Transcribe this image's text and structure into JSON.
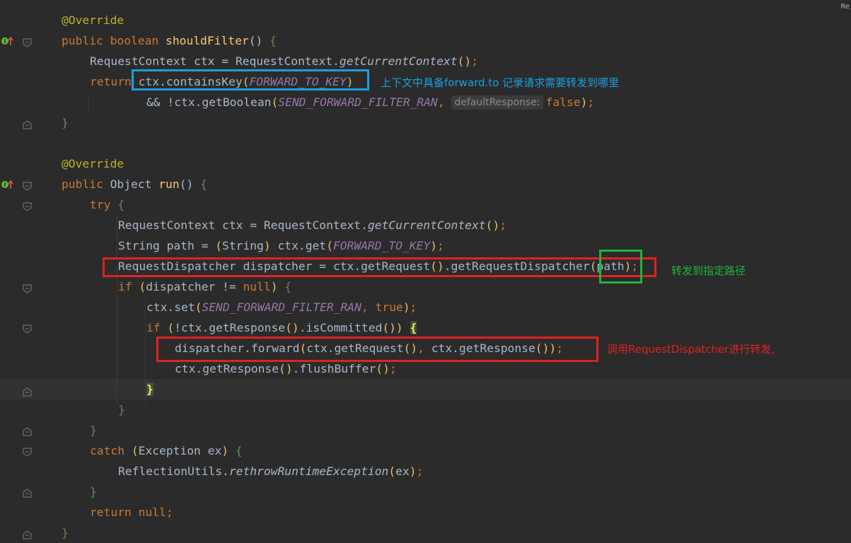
{
  "editor": {
    "corner_label": "Re",
    "lines": [
      {
        "indent": 2,
        "tokens": [
          {
            "t": "@Override",
            "c": "ann"
          }
        ]
      },
      {
        "indent": 2,
        "tokens": [
          {
            "t": "public boolean ",
            "c": "kw"
          },
          {
            "t": "shouldFilter",
            "c": "fn"
          },
          {
            "t": "() ",
            "c": "plain"
          },
          {
            "t": "{",
            "c": "brace-g"
          }
        ]
      },
      {
        "indent": 3,
        "tokens": [
          {
            "t": "RequestContext ctx = RequestContext.",
            "c": "plain"
          },
          {
            "t": "getCurrentContext",
            "c": "static-call"
          },
          {
            "t": "()",
            "c": "paren"
          },
          {
            "t": ";",
            "c": "kw"
          }
        ]
      },
      {
        "indent": 3,
        "tokens": [
          {
            "t": "return ",
            "c": "kw"
          },
          {
            "t": "ctx.containsKey",
            "c": "plain"
          },
          {
            "t": "(",
            "c": "paren"
          },
          {
            "t": "FORWARD_TO_KEY",
            "c": "const"
          },
          {
            "t": ")",
            "c": "paren"
          }
        ]
      },
      {
        "indent": 5,
        "tokens": [
          {
            "t": "&& !ctx.getBoolean",
            "c": "plain"
          },
          {
            "t": "(",
            "c": "paren"
          },
          {
            "t": "SEND_FORWARD_FILTER_RAN",
            "c": "const"
          },
          {
            "t": ", ",
            "c": "kw"
          },
          {
            "t": "defaultResponse:",
            "c": "hint"
          },
          {
            "t": "false",
            "c": "kw"
          },
          {
            "t": ")",
            "c": "paren"
          },
          {
            "t": ";",
            "c": "kw"
          }
        ]
      },
      {
        "indent": 2,
        "tokens": [
          {
            "t": "}",
            "c": "brace-g"
          }
        ]
      },
      {
        "indent": 0,
        "tokens": []
      },
      {
        "indent": 2,
        "tokens": [
          {
            "t": "@Override",
            "c": "ann"
          }
        ]
      },
      {
        "indent": 2,
        "tokens": [
          {
            "t": "public ",
            "c": "kw"
          },
          {
            "t": "Object ",
            "c": "plain"
          },
          {
            "t": "run",
            "c": "fn"
          },
          {
            "t": "() ",
            "c": "plain"
          },
          {
            "t": "{",
            "c": "brace-g"
          }
        ]
      },
      {
        "indent": 3,
        "tokens": [
          {
            "t": "try ",
            "c": "kw"
          },
          {
            "t": "{",
            "c": "brace-g"
          }
        ]
      },
      {
        "indent": 4,
        "tokens": [
          {
            "t": "RequestContext ctx = RequestContext.",
            "c": "plain"
          },
          {
            "t": "getCurrentContext",
            "c": "static-call"
          },
          {
            "t": "()",
            "c": "paren"
          },
          {
            "t": ";",
            "c": "kw"
          }
        ]
      },
      {
        "indent": 4,
        "tokens": [
          {
            "t": "String path = ",
            "c": "plain"
          },
          {
            "t": "(",
            "c": "paren"
          },
          {
            "t": "String",
            "c": "plain"
          },
          {
            "t": ") ",
            "c": "paren"
          },
          {
            "t": "ctx.get",
            "c": "plain"
          },
          {
            "t": "(",
            "c": "paren"
          },
          {
            "t": "FORWARD_TO_KEY",
            "c": "const"
          },
          {
            "t": ")",
            "c": "paren"
          },
          {
            "t": ";",
            "c": "kw"
          }
        ]
      },
      {
        "indent": 4,
        "tokens": [
          {
            "t": "RequestDispatcher dispatcher = ctx.getRequest",
            "c": "plain"
          },
          {
            "t": "()",
            "c": "paren"
          },
          {
            "t": ".getRequestDispatcher",
            "c": "plain"
          },
          {
            "t": "(",
            "c": "paren"
          },
          {
            "t": "path",
            "c": "plain"
          },
          {
            "t": ")",
            "c": "paren"
          },
          {
            "t": ";",
            "c": "kw"
          }
        ]
      },
      {
        "indent": 4,
        "tokens": [
          {
            "t": "if ",
            "c": "kw"
          },
          {
            "t": "(",
            "c": "paren"
          },
          {
            "t": "dispatcher != ",
            "c": "plain"
          },
          {
            "t": "null",
            "c": "kw"
          },
          {
            "t": ") ",
            "c": "paren"
          },
          {
            "t": "{",
            "c": "brace-g"
          }
        ]
      },
      {
        "indent": 5,
        "tokens": [
          {
            "t": "ctx.set",
            "c": "plain"
          },
          {
            "t": "(",
            "c": "paren"
          },
          {
            "t": "SEND_FORWARD_FILTER_RAN",
            "c": "const"
          },
          {
            "t": ", ",
            "c": "kw"
          },
          {
            "t": "true",
            "c": "kw"
          },
          {
            "t": ")",
            "c": "paren"
          },
          {
            "t": ";",
            "c": "kw"
          }
        ]
      },
      {
        "indent": 5,
        "tokens": [
          {
            "t": "if ",
            "c": "kw"
          },
          {
            "t": "(",
            "c": "paren"
          },
          {
            "t": "!ctx.getResponse",
            "c": "plain"
          },
          {
            "t": "()",
            "c": "paren"
          },
          {
            "t": ".isCommitted",
            "c": "plain"
          },
          {
            "t": "()) ",
            "c": "paren"
          },
          {
            "t": "{",
            "c": "hl-brace"
          }
        ]
      },
      {
        "indent": 6,
        "tokens": [
          {
            "t": "dispatcher.forward",
            "c": "plain"
          },
          {
            "t": "(",
            "c": "paren"
          },
          {
            "t": "ctx.getRequest",
            "c": "plain"
          },
          {
            "t": "()",
            "c": "paren"
          },
          {
            "t": ", ",
            "c": "kw"
          },
          {
            "t": "ctx.getResponse",
            "c": "plain"
          },
          {
            "t": "())",
            "c": "paren"
          },
          {
            "t": ";",
            "c": "kw"
          }
        ]
      },
      {
        "indent": 6,
        "tokens": [
          {
            "t": "ctx.getResponse",
            "c": "plain"
          },
          {
            "t": "()",
            "c": "paren"
          },
          {
            "t": ".flushBuffer",
            "c": "plain"
          },
          {
            "t": "()",
            "c": "paren"
          },
          {
            "t": ";",
            "c": "kw"
          }
        ]
      },
      {
        "indent": 5,
        "current": true,
        "tokens": [
          {
            "t": "}",
            "c": "hl-brace"
          }
        ]
      },
      {
        "indent": 4,
        "tokens": [
          {
            "t": "}",
            "c": "brace-g"
          }
        ]
      },
      {
        "indent": 3,
        "tokens": [
          {
            "t": "}",
            "c": "brace-g"
          }
        ]
      },
      {
        "indent": 3,
        "tokens": [
          {
            "t": "catch ",
            "c": "kw"
          },
          {
            "t": "(",
            "c": "paren"
          },
          {
            "t": "Exception ex",
            "c": "plain"
          },
          {
            "t": ") ",
            "c": "paren"
          },
          {
            "t": "{",
            "c": "brace-g"
          }
        ]
      },
      {
        "indent": 4,
        "tokens": [
          {
            "t": "ReflectionUtils.",
            "c": "plain"
          },
          {
            "t": "rethrowRuntimeException",
            "c": "static-call"
          },
          {
            "t": "(",
            "c": "paren"
          },
          {
            "t": "ex",
            "c": "plain"
          },
          {
            "t": ")",
            "c": "paren"
          },
          {
            "t": ";",
            "c": "kw"
          }
        ]
      },
      {
        "indent": 3,
        "tokens": [
          {
            "t": "}",
            "c": "brace-g"
          }
        ]
      },
      {
        "indent": 3,
        "tokens": [
          {
            "t": "return null",
            "c": "kw"
          },
          {
            "t": ";",
            "c": "kw"
          }
        ]
      },
      {
        "indent": 2,
        "tokens": [
          {
            "t": "}",
            "c": "brace-g"
          }
        ]
      }
    ]
  },
  "annotations": {
    "blue_note": "上下文中具备forward.to 记录请求需要转发到哪里",
    "green_note": "转发到指定路径",
    "red_note": "调用RequestDispatcher进行转发,"
  },
  "colors": {
    "background": "#2b2b2b",
    "keyword": "#cc7832",
    "annotation": "#bbb529",
    "method_decl": "#ffc66d",
    "constant": "#9876aa",
    "text": "#a9b7c6",
    "blue_box": "#1a9fe0",
    "green_box": "#1fb53a",
    "red_box": "#e02121"
  }
}
